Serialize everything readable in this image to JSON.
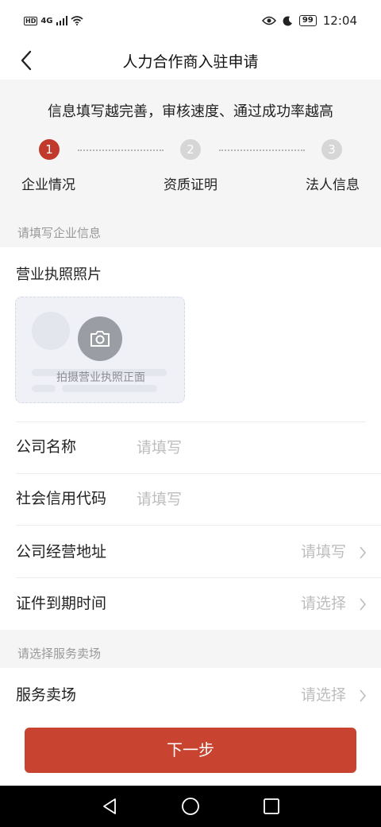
{
  "status_bar": {
    "hd": "HD",
    "network": "4G",
    "battery": "99",
    "time": "12:04"
  },
  "nav": {
    "title": "人力合作商入驻申请",
    "back_icon": "chevron-left-icon"
  },
  "progress": {
    "tip": "信息填写越完善，审核速度、通过成功率越高",
    "steps": [
      {
        "number": "1",
        "label": "企业情况",
        "state": "active"
      },
      {
        "number": "2",
        "label": "资质证明",
        "state": "inactive"
      },
      {
        "number": "3",
        "label": "法人信息",
        "state": "inactive"
      }
    ]
  },
  "section_company": {
    "header": "请填写企业信息",
    "license_label": "营业执照照片",
    "upload_text": "拍摄营业执照正面",
    "upload_icon": "camera-icon"
  },
  "fields": {
    "company_name": {
      "label": "公司名称",
      "placeholder": "请填写"
    },
    "credit_code": {
      "label": "社会信用代码",
      "placeholder": "请填写"
    },
    "address": {
      "label": "公司经营地址",
      "value": "请填写"
    },
    "expiry": {
      "label": "证件到期时间",
      "value": "请选择"
    }
  },
  "section_service": {
    "header": "请选择服务卖场",
    "venue": {
      "label": "服务卖场",
      "value": "请选择"
    }
  },
  "next_button": "下一步",
  "colors": {
    "accent": "#c84430",
    "step_active": "#c0392b",
    "step_inactive": "#d6d6d6",
    "section_bg": "#f5f5f5",
    "placeholder": "#bdbdbd"
  }
}
